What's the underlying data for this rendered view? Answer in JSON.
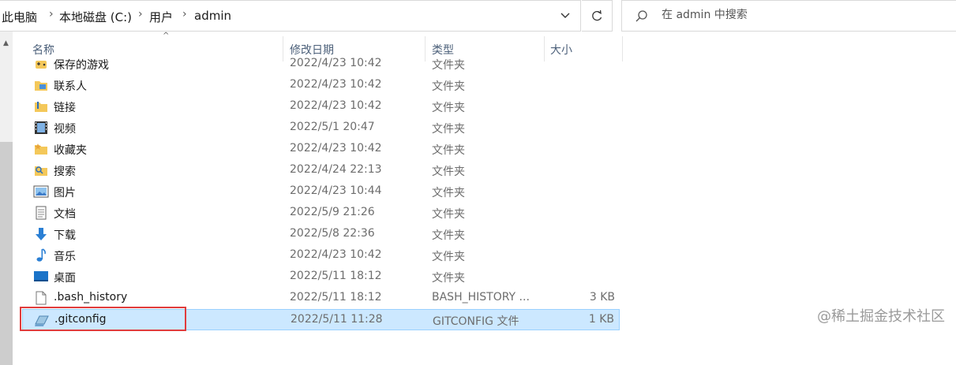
{
  "breadcrumb": [
    "此电脑",
    "本地磁盘 (C:)",
    "用户",
    "admin"
  ],
  "search": {
    "placeholder": "在 admin 中搜索"
  },
  "columns": {
    "name": "名称",
    "date": "修改日期",
    "type": "类型",
    "size": "大小"
  },
  "files": [
    {
      "name": "保存的游戏",
      "date": "2022/4/23 10:42",
      "type": "文件夹",
      "size": "",
      "icon": "saved-games-icon"
    },
    {
      "name": "联系人",
      "date": "2022/4/23 10:42",
      "type": "文件夹",
      "size": "",
      "icon": "contacts-icon"
    },
    {
      "name": "链接",
      "date": "2022/4/23 10:42",
      "type": "文件夹",
      "size": "",
      "icon": "links-icon"
    },
    {
      "name": "视频",
      "date": "2022/5/1 20:47",
      "type": "文件夹",
      "size": "",
      "icon": "videos-icon"
    },
    {
      "name": "收藏夹",
      "date": "2022/4/23 10:42",
      "type": "文件夹",
      "size": "",
      "icon": "favorites-icon"
    },
    {
      "name": "搜索",
      "date": "2022/4/24 22:13",
      "type": "文件夹",
      "size": "",
      "icon": "searches-icon"
    },
    {
      "name": "图片",
      "date": "2022/4/23 10:44",
      "type": "文件夹",
      "size": "",
      "icon": "pictures-icon"
    },
    {
      "name": "文档",
      "date": "2022/5/9 21:26",
      "type": "文件夹",
      "size": "",
      "icon": "documents-icon"
    },
    {
      "name": "下载",
      "date": "2022/5/8 22:36",
      "type": "文件夹",
      "size": "",
      "icon": "downloads-icon"
    },
    {
      "name": "音乐",
      "date": "2022/4/23 10:42",
      "type": "文件夹",
      "size": "",
      "icon": "music-icon"
    },
    {
      "name": "桌面",
      "date": "2022/5/11 18:12",
      "type": "文件夹",
      "size": "",
      "icon": "desktop-icon"
    },
    {
      "name": ".bash_history",
      "date": "2022/5/11 18:12",
      "type": "BASH_HISTORY ...",
      "size": "3 KB",
      "icon": "file-icon"
    },
    {
      "name": ".gitconfig",
      "date": "2022/5/11 11:28",
      "type": "GITCONFIG 文件",
      "size": "1 KB",
      "icon": "gitconfig-file-icon",
      "selected": true
    }
  ],
  "watermark": "@稀土掘金技术社区",
  "colors": {
    "selection": "#cce8ff",
    "selection_border": "#99d1ff",
    "highlight": "#e03c3c",
    "header_text": "#4c607a"
  }
}
